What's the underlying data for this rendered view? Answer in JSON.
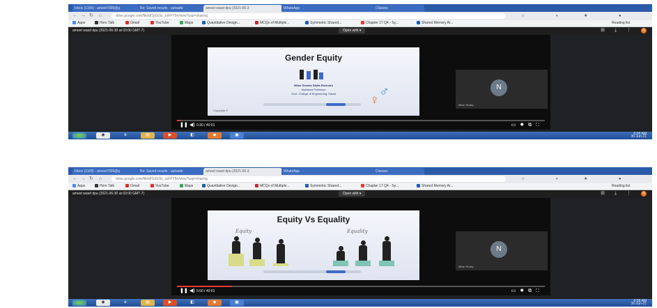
{
  "screens": [
    {
      "tabs": [
        "Inbox (1109) - ameet7009@g",
        "Re: Saved results - uploade",
        "ameet wasd dpu (2021-06-3",
        "WhatsApp",
        "Classes"
      ],
      "url": "drive.google.com/file/d/1b0c9z_zsFFY5n/view?usp=sharing",
      "bookmarks": [
        "Apps",
        "Hero Talk",
        "Gmail",
        "YouTube",
        "Maps",
        "Quantitative Design...",
        "MCQs of Multiple...",
        "Symmetric Shared...",
        "Chapter 17 Q4 - Sy...",
        "Shared Memory Ar..."
      ],
      "reading_list": "Reading list",
      "drive_title": "ameet wasd dpu (2021-06-30 at 03:00 GMT-7)",
      "open_with": "Open with ▾",
      "avatar_letter": "N",
      "slide": {
        "title": "Gender Equity",
        "author": "Milan Shasha Nikita Ravindra",
        "role": "Assistant Professor",
        "org": "Govt. College of Engineering, Karad",
        "footer": "Copyright ©"
      },
      "participant": {
        "letter": "N",
        "name": "Milan Shaky"
      },
      "time": "0:30 / 40:01",
      "progress_pct": 1,
      "tray_time": "6:56 AM",
      "tray_date": "30-Jun-21"
    },
    {
      "tabs": [
        "Inbox (1109) - ameet7009@g",
        "Re: Saved results - uploade",
        "ameet wasd dpu (2021-06-3",
        "WhatsApp",
        "Classes"
      ],
      "url": "drive.google.com/file/d/1b0c9z_zsFFY5n/view?usp=sharing",
      "bookmarks": [
        "Apps",
        "Hero Talk",
        "Gmail",
        "YouTube",
        "Maps",
        "Quantitative Design...",
        "MCQs of Multiple...",
        "Symmetric Shared...",
        "Chapter 17 Q4 - Sy...",
        "Shared Memory Ar..."
      ],
      "reading_list": "Reading list",
      "drive_title": "ameet wasd dpu (2021-06-30 at 03:00 GMT-7)",
      "open_with": "Open with ▾",
      "avatar_letter": "N",
      "slide": {
        "title": "Equity Vs Equality",
        "label_left": "Equity",
        "label_right": "Equality",
        "footer": ""
      },
      "participant": {
        "letter": "N",
        "name": "Milan Shaky"
      },
      "time": "5:50 / 40:01",
      "progress_pct": 15,
      "tray_time": "6:58 AM",
      "tray_date": "30-Jun-21"
    }
  ],
  "colors": {
    "accent_red": "#e53935",
    "taskbar": "#2a5aa8",
    "avatar": "#e8711a"
  }
}
